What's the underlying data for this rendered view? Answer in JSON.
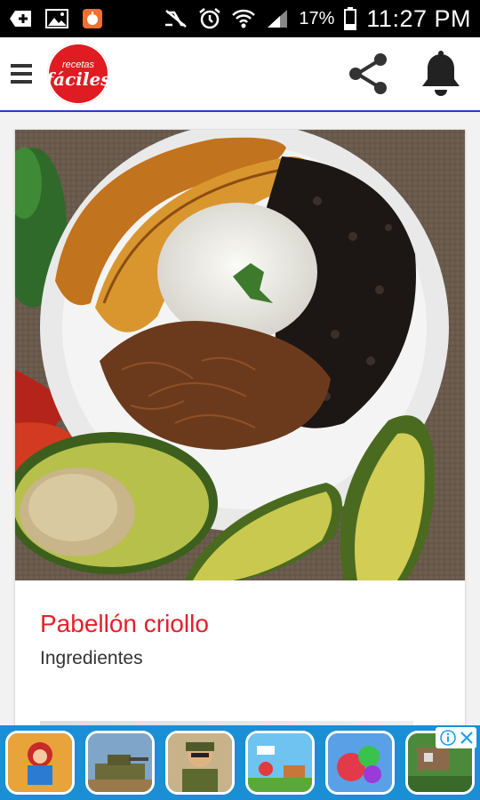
{
  "status_bar": {
    "battery_pct": "17%",
    "time": "11:27 PM",
    "icons": [
      "add-icon",
      "image-icon",
      "notification-app-icon",
      "nfc-muted-icon",
      "alarm-icon",
      "wifi-icon",
      "signal-icon",
      "battery-icon"
    ]
  },
  "app_bar": {
    "logo_top": "recetas",
    "logo_main": "fáciles",
    "icons": [
      "menu-icon",
      "share-icon",
      "bell-icon"
    ],
    "accent": "#2a3bbf"
  },
  "recipe": {
    "title": "Pabellón criollo",
    "subtitle": "Ingredientes",
    "title_color": "#e4202a"
  },
  "ad": {
    "apps": [
      "subway-runner-icon",
      "tank-game-icon",
      "soldier-game-icon",
      "platform-game-icon",
      "candy-game-icon",
      "farm-game-icon"
    ],
    "info_icons": [
      "info-icon",
      "close-icon"
    ],
    "bg_color": "#1a8fd6"
  }
}
